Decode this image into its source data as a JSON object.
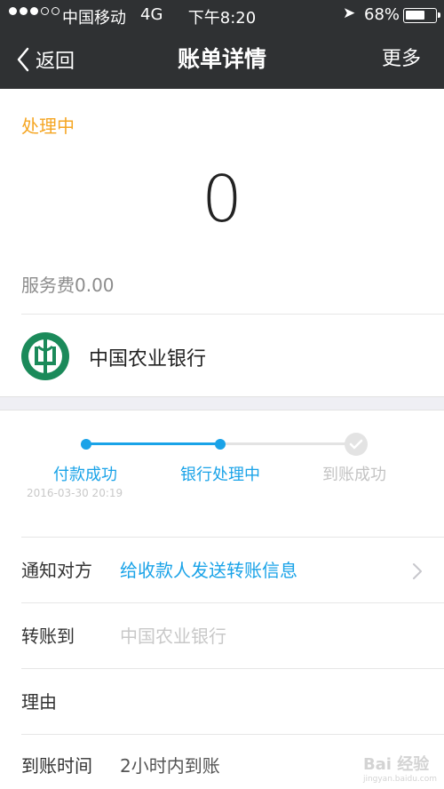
{
  "status_bar": {
    "carrier": "中国移动",
    "network": "4G",
    "time": "下午8:20",
    "battery": "68%",
    "battery_level": 0.68
  },
  "nav": {
    "back_label": "返回",
    "title": "账单详情",
    "more_label": "更多"
  },
  "transfer": {
    "status": "处理中",
    "amount": "0",
    "fee": "服务费0.00",
    "bank_name": "中国农业银行"
  },
  "progress": {
    "steps": [
      {
        "label": "付款成功",
        "time": "2016-03-30 20:19",
        "state": "done"
      },
      {
        "label": "银行处理中",
        "time": "",
        "state": "active"
      },
      {
        "label": "到账成功",
        "time": "",
        "state": "pending"
      }
    ],
    "active_color": "#1aa3e8",
    "pending_color": "#e3e3e3"
  },
  "details": {
    "notify": {
      "label": "通知对方",
      "value": "给收款人发送转账信息"
    },
    "transfer_to": {
      "label": "转账到",
      "value": "中国农业银行"
    },
    "reason": {
      "label": "理由",
      "value": ""
    },
    "arrival": {
      "label": "到账时间",
      "value": "2小时内到账"
    }
  },
  "watermark": {
    "text": "Bai 经验",
    "sub": "jingyan.baidu.com"
  },
  "colors": {
    "header_bg": "#2f3133",
    "accent": "#1aa3e8",
    "status_orange": "#f5a623"
  }
}
